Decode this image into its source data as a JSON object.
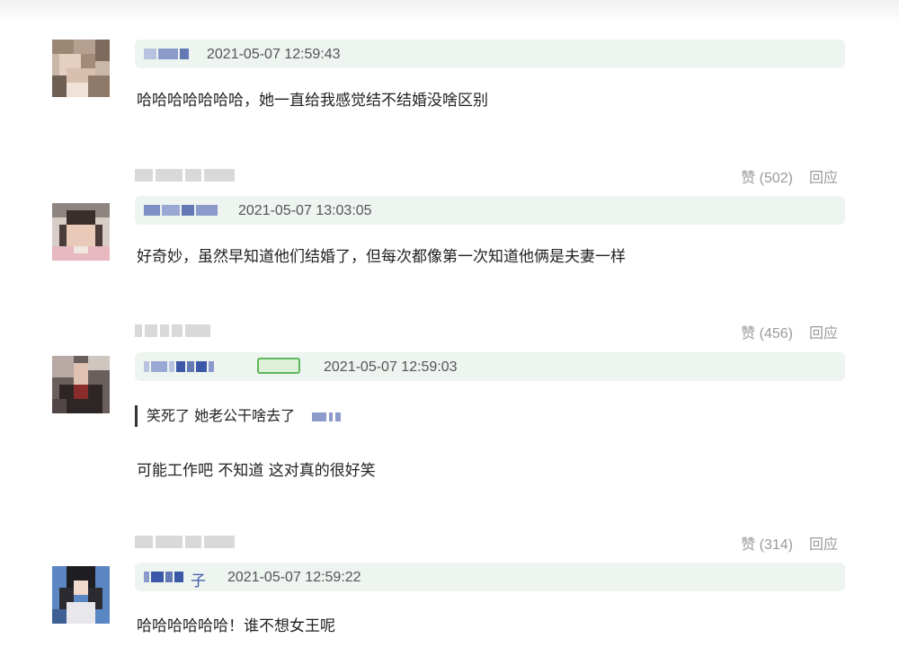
{
  "colors": {
    "bar_bg": "#eef4f0",
    "name_blue": "#3b59a8",
    "muted": "#9a9a9a",
    "badge_green": "#5cb85c"
  },
  "comments": [
    {
      "timestamp": "2021-05-07 12:59:43",
      "text": "哈哈哈哈哈哈哈，她一直给我感觉结不结婚没啥区别",
      "footer": {
        "likes": "赞 (502)",
        "reply": "回应"
      }
    },
    {
      "timestamp": "2021-05-07 13:03:05",
      "text": "好奇妙，虽然早知道他们结婚了，但每次都像第一次知道他俩是夫妻一样",
      "footer": {
        "likes": "赞 (456)",
        "reply": "回应"
      }
    },
    {
      "timestamp": "2021-05-07 12:59:03",
      "quote": "笑死了 她老公干啥去了",
      "text": "可能工作吧 不知道 这对真的很好笑",
      "footer": {
        "likes": "赞 (314)",
        "reply": "回应"
      }
    },
    {
      "name_suffix": "子",
      "timestamp": "2021-05-07 12:59:22",
      "text": "哈哈哈哈哈哈！谁不想女王呢"
    }
  ]
}
